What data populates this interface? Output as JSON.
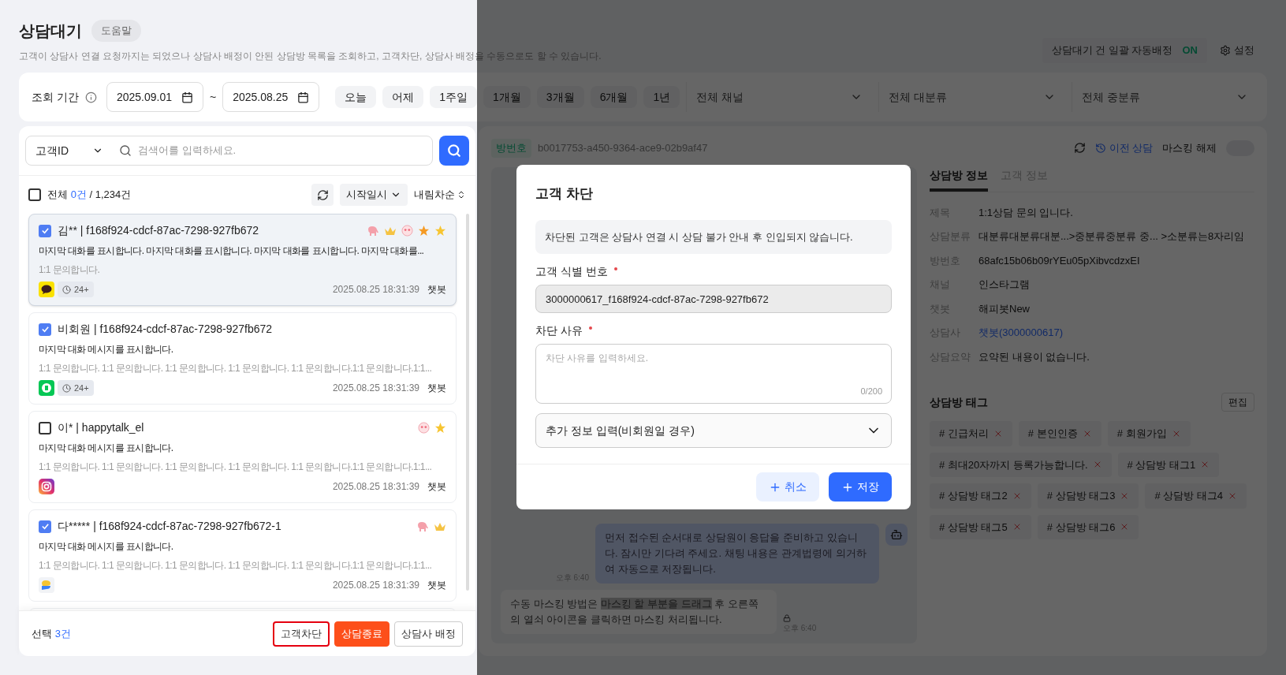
{
  "page": {
    "title": "상담대기",
    "help_button": "도움말",
    "description": "고객이 상담사 연결 요청까지는 되었으나 상담사 배정이 안된 상담방 목록을 조회하고, 고객차단, 상담사 배정을 수동으로도 할 수 있습니다.",
    "auto_assign": {
      "label": "상담대기 건 일괄 자동배정",
      "state": "ON",
      "on": true
    },
    "settings_button": "설정"
  },
  "filters": {
    "period_label": "조회 기간",
    "start_date": "2025.09.01",
    "separator": "~",
    "end_date": "2025.08.25",
    "quick_ranges": [
      "오늘",
      "어제",
      "1주일",
      "1개월",
      "3개월",
      "6개월",
      "1년"
    ],
    "dropdowns": [
      "전체 채널",
      "전체 대분류",
      "전체 중분류"
    ]
  },
  "list": {
    "search_type": "고객ID",
    "search_placeholder": "검색어를 입력하세요.",
    "select_all": {
      "checked": false,
      "label": "전체",
      "count": "0건",
      "total": "/ 1,234건"
    },
    "sort_field": "시작일시",
    "sort_order": "내림차순",
    "items": [
      {
        "selected": true,
        "checked": true,
        "title": "김** | f168f924-cdcf-87ac-7298-927fb672",
        "badges": [
          {
            "kind": "elephant"
          },
          {
            "kind": "crown"
          },
          {
            "kind": "face"
          },
          {
            "kind": "star-orange"
          },
          {
            "kind": "star"
          }
        ],
        "message": "마지막 대화를 표시합니다.  마지막 대화를 표시합니다. 마지막 대화를 표시합니다. 마지막 대화를...",
        "sub": "1:1 문의합니다.",
        "channel": {
          "kind": "kakao"
        },
        "wait": "24+",
        "time": "2025.08.25 18:31:39",
        "agent": "챗봇"
      },
      {
        "selected": false,
        "checked": true,
        "title": "비회원 | f168f924-cdcf-87ac-7298-927fb672",
        "message": "마지막 대화 메시지를 표시합니다.",
        "sub": "1:1 문의합니다. 1:1 문의합니다. 1:1 문의합니다. 1:1 문의합니다. 1:1 문의합니다.1:1 문의합니다.1:1...",
        "channel": {
          "kind": "green"
        },
        "wait": "24+",
        "time": "2025.08.25 18:31:39",
        "agent": "챗봇"
      },
      {
        "selected": false,
        "checked": false,
        "title": "이* | happytalk_el",
        "badges": [
          {
            "kind": "face"
          },
          {
            "kind": "star"
          }
        ],
        "message": "마지막 대화 메시지를 표시합니다.",
        "sub": "1:1 문의합니다. 1:1 문의합니다. 1:1 문의합니다. 1:1 문의합니다. 1:1 문의합니다.1:1 문의합니다.1:1...",
        "channel": {
          "kind": "instagram"
        },
        "time": "2025.08.25 18:31:39",
        "agent": "챗봇"
      },
      {
        "selected": false,
        "checked": true,
        "title": "다***** | f168f924-cdcf-87ac-7298-927fb672-1",
        "badges": [
          {
            "kind": "elephant"
          },
          {
            "kind": "crown"
          }
        ],
        "message": "마지막 대화 메시지를 표시합니다.",
        "sub": "1:1 문의합니다. 1:1 문의합니다. 1:1 문의합니다. 1:1 문의합니다. 1:1 문의합니다.1:1 문의합니다.1:1...",
        "channel": {
          "kind": "bubble"
        },
        "time": "2025.08.25 18:31:39",
        "agent": "챗봇"
      }
    ]
  },
  "footer": {
    "selected_label": "선택",
    "selected_count": "3건",
    "buttons": [
      {
        "label": "고객차단",
        "kind": "outlined"
      },
      {
        "label": "상담종료",
        "kind": "danger"
      },
      {
        "label": "상담사 배정",
        "kind": "default"
      }
    ]
  },
  "detail": {
    "room_label": "방번호",
    "room_id": "b0017753-a450-9364-ace9-02b9af47",
    "history_button": "이전 상담",
    "masking_label": "마스킹 해제",
    "masking_on": false,
    "messages": [
      {
        "kind": "bot",
        "text": "먼저 접수된 순서대로 상담원이 응답을 준비하고 있습니다. 잠시만 기다려 주세요. 채팅 내용은 관계법령에 의거하여 자동으로 저장됩니다.",
        "time": "오후 6:40"
      },
      {
        "kind": "customer",
        "before": "수동 마스킹 방법은 ",
        "highlight": "마스킹 할 부분을 드래그",
        "after": " 후 오른쪽의 열쇠 아이콘을 클릭하면 마스킹 처리됩니다.",
        "time": "오후 6:40"
      }
    ],
    "tabs": [
      {
        "label": "상담방 정보",
        "selected": true
      },
      {
        "label": "고객 정보",
        "selected": false
      }
    ],
    "info": [
      {
        "label": "제목",
        "value": "1:1상담 문의 입니다.",
        "kind": "text"
      },
      {
        "label": "상담분류",
        "value": "대분류대분류대분...>중분류중분류 중...  >소분류는8자리임",
        "kind": "text"
      },
      {
        "label": "방번호",
        "value": "68afc15b06b09rYEu05pXibvcdzxEI",
        "kind": "text"
      },
      {
        "label": "채널",
        "value": "인스타그램",
        "kind": "text"
      },
      {
        "label": "챗봇",
        "value": "해피봇New",
        "kind": "text"
      },
      {
        "label": "상담사",
        "value": "챗봇(3000000617)",
        "kind": "link"
      },
      {
        "label": "상담요약",
        "value": "요약된 내용이 없습니다.",
        "kind": "text"
      }
    ],
    "tags_title": "상담방 태그",
    "edit_button": "편집",
    "tags": [
      "# 긴급처리",
      "# 본인인증",
      "# 회원가입",
      "# 최대20자까지 등록가능합니다.",
      "# 상담방 태그1",
      "# 상담방 태그2",
      "# 상담방 태그3",
      "# 상담방 태그4",
      "# 상담방 태그5",
      "# 상담방 태그6"
    ]
  },
  "modal": {
    "title": "고객 차단",
    "notice": "차단된 고객은 상담사 연결 시 상담 불가 안내 후 인입되지 않습니다.",
    "id_label": "고객 식별 번호",
    "id_required": true,
    "id_value": "3000000617_f168f924-cdcf-87ac-7298-927fb672",
    "reason_label": "차단 사유",
    "reason_required": true,
    "reason_placeholder": "차단 사유를 입력하세요.",
    "reason_count": "0/200",
    "extra_label": "추가 정보 입력(비회원일 경우)",
    "extra_expanded": false,
    "cancel": "취소",
    "save": "저장"
  }
}
